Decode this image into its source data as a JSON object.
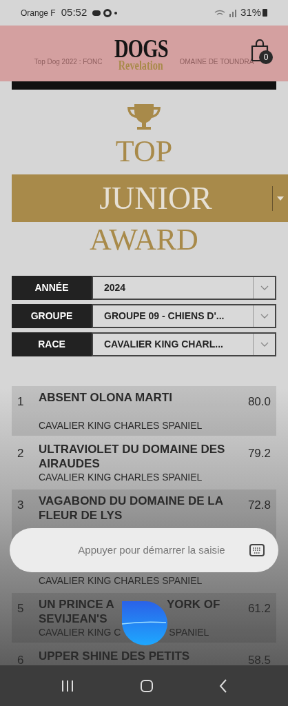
{
  "status_bar": {
    "carrier": "Orange F",
    "time": "05:52",
    "battery": "31%"
  },
  "header": {
    "ticker_left": "Top Dog 2022 : FONC",
    "ticker_right": "OMAINE DE TOUNDRA",
    "logo_top": "DOGS",
    "logo_bottom": "Revelation",
    "cart_count": "0"
  },
  "award": {
    "top": "TOP",
    "category": "JUNIOR",
    "bottom": "AWARD"
  },
  "filters": [
    {
      "label": "ANNÉE",
      "value": "2024"
    },
    {
      "label": "GROUPE",
      "value": "GROUPE 09 - CHIENS D'..."
    },
    {
      "label": "RACE",
      "value": "CAVALIER KING CHARL..."
    }
  ],
  "rankings": [
    {
      "kind": "full",
      "rank": "1",
      "name": "ABSENT OLONA MARTI",
      "score": "80.0",
      "breed": "CAVALIER KING CHARLES SPANIEL"
    },
    {
      "kind": "full",
      "rank": "2",
      "name": "ULTRAVIOLET DU DOMAINE DES AIRAUDES",
      "score": "79.2",
      "breed": "CAVALIER KING CHARLES SPANIEL"
    },
    {
      "kind": "full",
      "rank": "3",
      "name": "VAGABOND DU DOMAINE DE LA FLEUR DE LYS",
      "score": "72.8"
    },
    {
      "kind": "breed_only",
      "breed": "CAVALIER KING CHARLES SPANIEL"
    },
    {
      "kind": "split",
      "rank": "5",
      "name_parts": [
        "UN PRINCE A",
        "YORK OF",
        "SEVIJEAN'S"
      ],
      "score": "61.2",
      "breed_parts": [
        "CAVALIER KING C",
        "SPANIEL"
      ]
    },
    {
      "kind": "full",
      "rank": "6",
      "name": "UPPER SHINE DES PETITS",
      "score": "58.5"
    }
  ],
  "voice_input": {
    "placeholder": "Appuyer pour démarrer la saisie"
  }
}
